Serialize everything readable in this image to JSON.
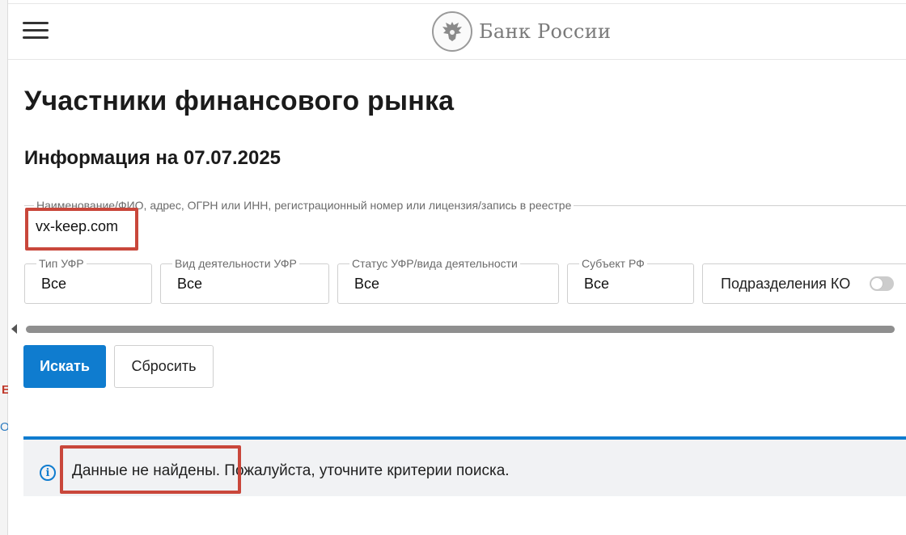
{
  "header": {
    "menu_icon": "hamburger-menu-icon",
    "logo_icon": "double-headed-eagle-emblem-icon",
    "brand": "Банк России"
  },
  "page": {
    "title": "Участники финансового рынка",
    "subtitle": "Информация на 07.07.2025"
  },
  "search": {
    "label": "Наименование/ФИО, адрес, ОГРН или ИНН, регистрационный номер или лицензия/запись в реестре",
    "value": "vx-keep.com"
  },
  "filters": [
    {
      "label": "Тип УФР",
      "value": "Все"
    },
    {
      "label": "Вид деятельности УФР",
      "value": "Все"
    },
    {
      "label": "Статус УФР/вида деятельности",
      "value": "Все"
    },
    {
      "label": "Субъект РФ",
      "value": "Все"
    }
  ],
  "toggle": {
    "label": "Подразделения КО",
    "on": false
  },
  "buttons": {
    "search": "Искать",
    "reset": "Сбросить"
  },
  "alert": {
    "icon": "info-icon",
    "text": "Данные не найдены. Пожалуйста, уточните критерии поиска."
  },
  "side_fragments": {
    "red": "Е",
    "blue": "О"
  },
  "colors": {
    "accent": "#0f7ccf",
    "highlight": "#c9473b",
    "alert_bg": "#f1f2f4"
  }
}
